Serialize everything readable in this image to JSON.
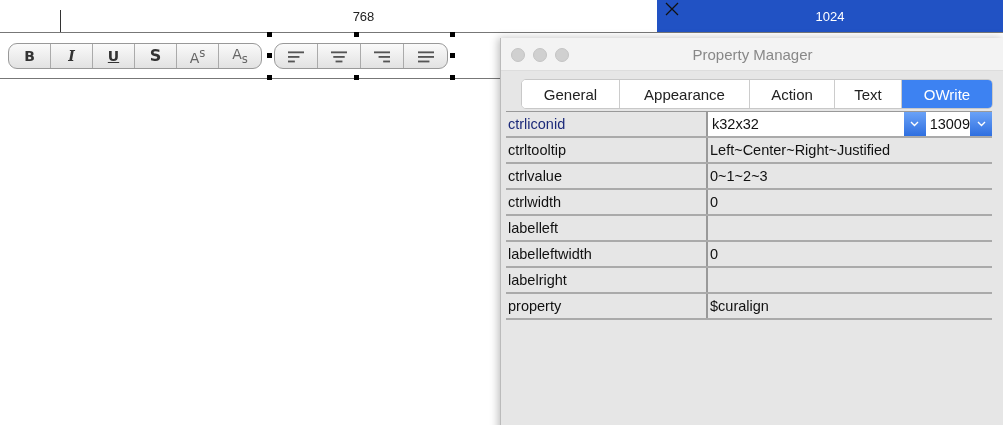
{
  "ruler": {
    "segments": [
      {
        "label": "768",
        "selected": false
      },
      {
        "label": "1024",
        "selected": true
      }
    ]
  },
  "format_buttons": [
    {
      "kind": "bold",
      "label": "B"
    },
    {
      "kind": "italic",
      "label": "I"
    },
    {
      "kind": "underline",
      "label": "U"
    },
    {
      "kind": "strike",
      "label": "S"
    },
    {
      "kind": "super",
      "label": "A$^{s}$"
    },
    {
      "kind": "sub",
      "label": "A$_{s}$"
    }
  ],
  "align_buttons": [
    {
      "kind": "left"
    },
    {
      "kind": "center"
    },
    {
      "kind": "right"
    },
    {
      "kind": "justify"
    }
  ],
  "window": {
    "title": "Property Manager",
    "tabs": [
      {
        "label": "General",
        "selected": false
      },
      {
        "label": "Appearance",
        "selected": false
      },
      {
        "label": "Action",
        "selected": false
      },
      {
        "label": "Text",
        "selected": false
      },
      {
        "label": "OWrite",
        "selected": true
      }
    ],
    "properties": [
      {
        "name": "ctrliconid",
        "kind": "combo",
        "selected": true,
        "value": "k32x32",
        "value_2": "13009"
      },
      {
        "name": "ctrltooltip",
        "kind": "text",
        "selected": false,
        "value": "Left~Center~Right~Justified"
      },
      {
        "name": "ctrlvalue",
        "kind": "text",
        "selected": false,
        "value": "0~1~2~3"
      },
      {
        "name": "ctrlwidth",
        "kind": "text",
        "selected": false,
        "value": "0"
      },
      {
        "name": "labelleft",
        "kind": "text",
        "selected": false
      },
      {
        "name": "labelleftwidth",
        "kind": "text",
        "selected": false,
        "value": "0"
      },
      {
        "name": "labelright",
        "kind": "text",
        "selected": false
      },
      {
        "name": "property",
        "kind": "text",
        "selected": false,
        "value": "$curalign"
      }
    ]
  }
}
